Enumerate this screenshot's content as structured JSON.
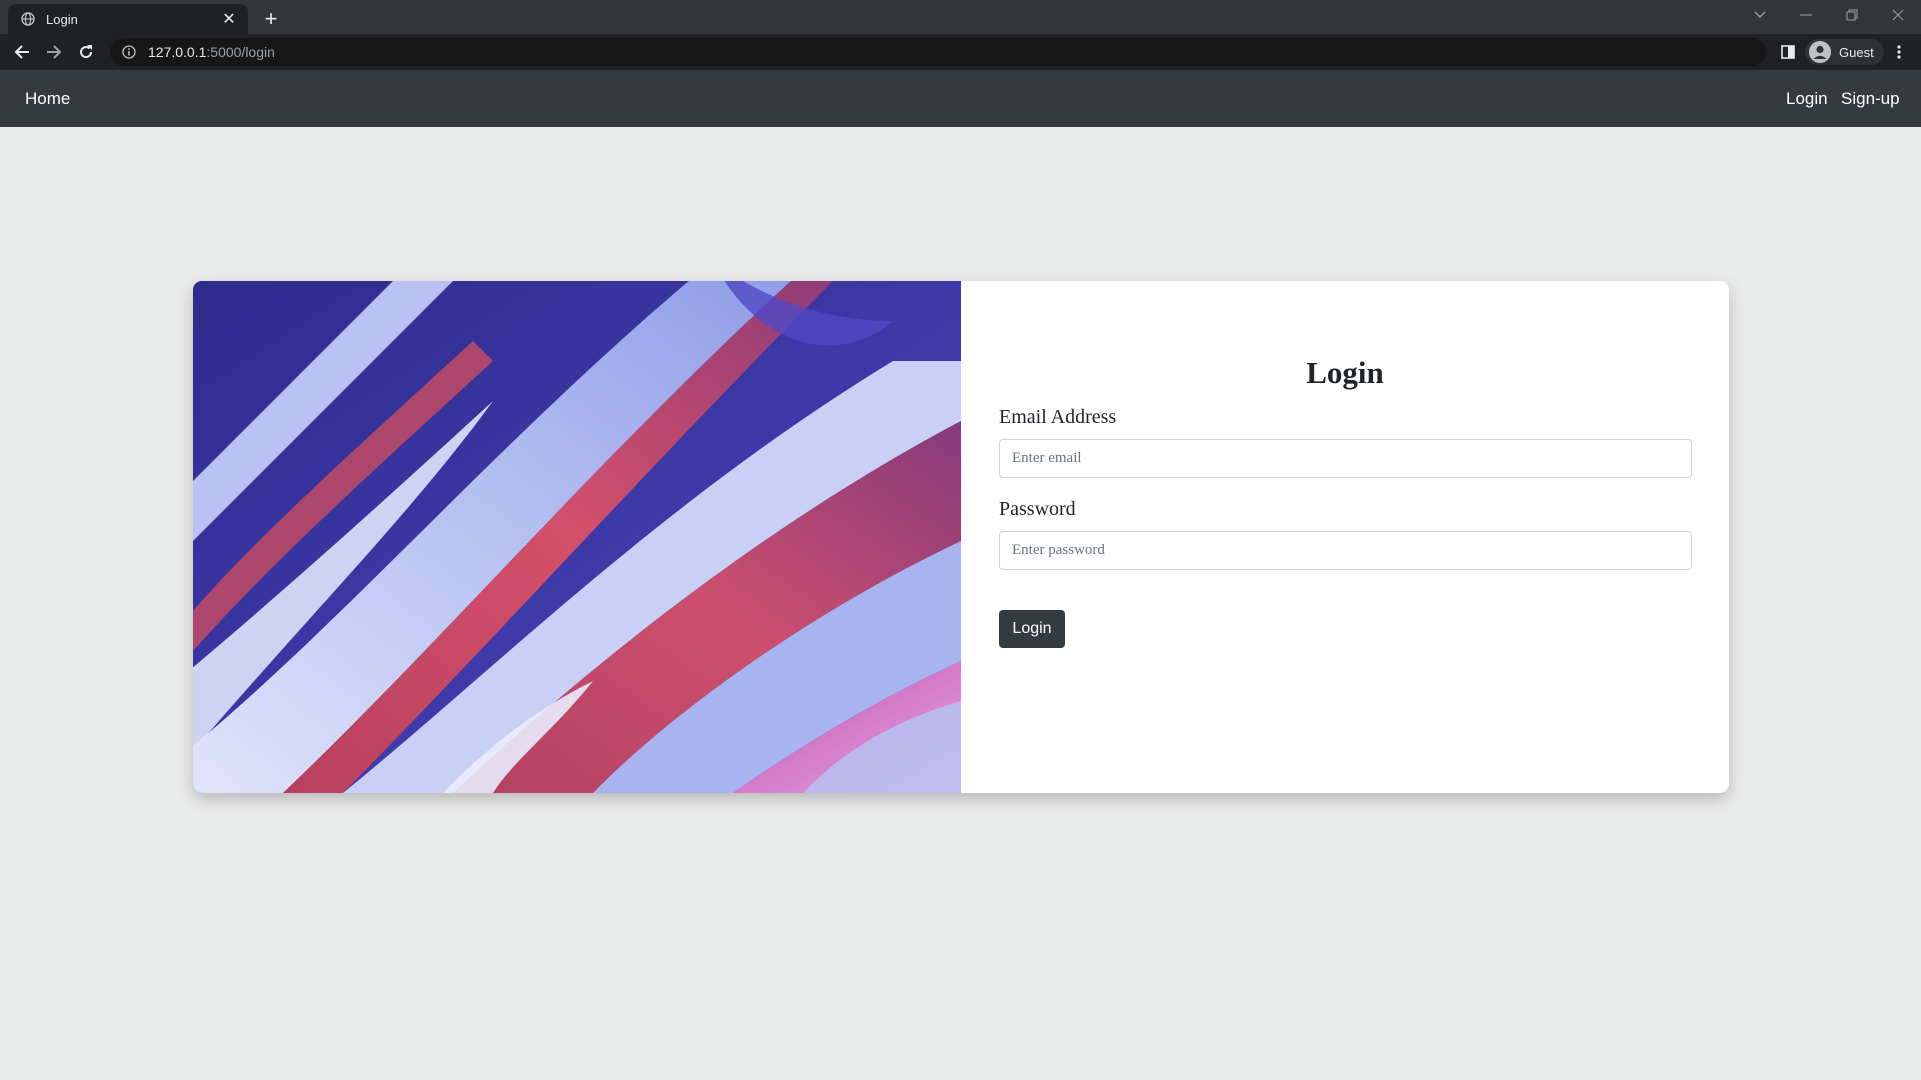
{
  "browser": {
    "tab_title": "Login",
    "url_host": "127.0.0.1",
    "url_path": ":5000/login",
    "profile_label": "Guest"
  },
  "navbar": {
    "brand": "Home",
    "links": [
      "Login",
      "Sign-up"
    ]
  },
  "login_form": {
    "title": "Login",
    "email_label": "Email Address",
    "email_placeholder": "Enter email",
    "password_label": "Password",
    "password_placeholder": "Enter password",
    "submit_label": "Login"
  },
  "colors": {
    "navbar_bg": "#343a40",
    "page_bg": "#eaebeb",
    "button_bg": "#343a40"
  }
}
